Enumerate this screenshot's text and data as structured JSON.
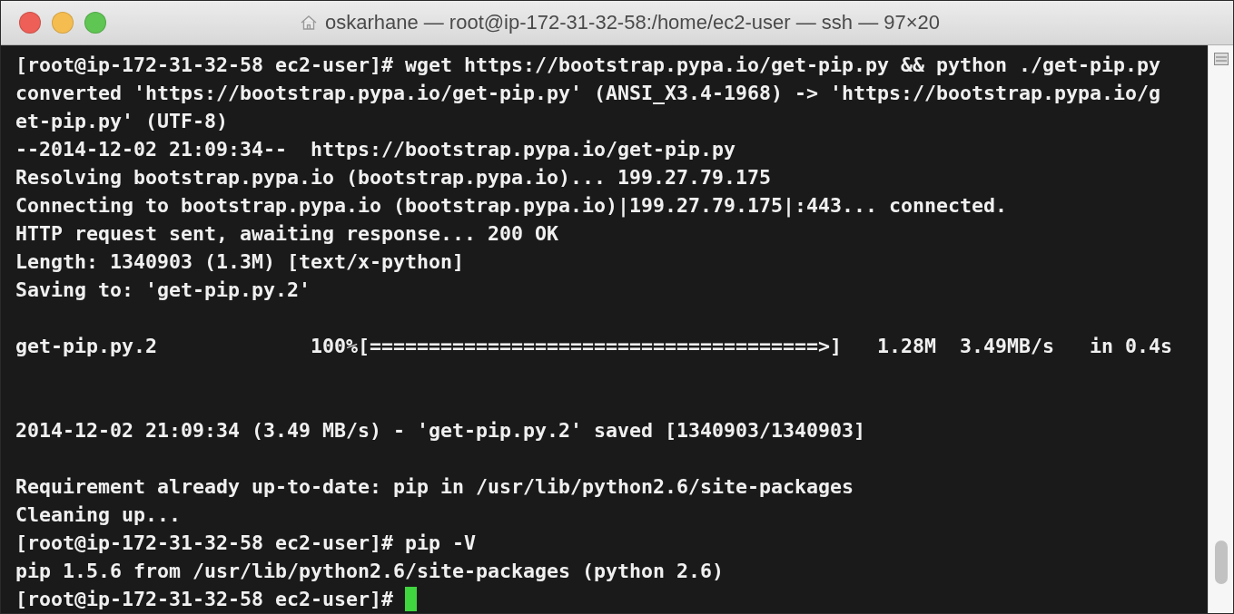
{
  "window": {
    "title": "oskarhane — root@ip-172-31-32-58:/home/ec2-user — ssh — 97×20"
  },
  "terminal": {
    "lines": [
      {
        "kind": "text",
        "text": "[root@ip-172-31-32-58 ec2-user]# wget https://bootstrap.pypa.io/get-pip.py && python ./get-pip.py",
        "cursor": false
      },
      {
        "kind": "text",
        "text": "converted 'https://bootstrap.pypa.io/get-pip.py' (ANSI_X3.4-1968) -> 'https://bootstrap.pypa.io/g",
        "cursor": false
      },
      {
        "kind": "text",
        "text": "et-pip.py' (UTF-8)",
        "cursor": false
      },
      {
        "kind": "text",
        "text": "--2014-12-02 21:09:34--  https://bootstrap.pypa.io/get-pip.py",
        "cursor": false
      },
      {
        "kind": "text",
        "text": "Resolving bootstrap.pypa.io (bootstrap.pypa.io)... 199.27.79.175",
        "cursor": false
      },
      {
        "kind": "text",
        "text": "Connecting to bootstrap.pypa.io (bootstrap.pypa.io)|199.27.79.175|:443... connected.",
        "cursor": false
      },
      {
        "kind": "text",
        "text": "HTTP request sent, awaiting response... 200 OK",
        "cursor": false
      },
      {
        "kind": "text",
        "text": "Length: 1340903 (1.3M) [text/x-python]",
        "cursor": false
      },
      {
        "kind": "text",
        "text": "Saving to: 'get-pip.py.2'",
        "cursor": false
      },
      {
        "kind": "blank"
      },
      {
        "kind": "text",
        "text": "get-pip.py.2             100%[======================================>]   1.28M  3.49MB/s   in 0.4s",
        "cursor": false
      },
      {
        "kind": "blank"
      },
      {
        "kind": "blank"
      },
      {
        "kind": "text",
        "text": "2014-12-02 21:09:34 (3.49 MB/s) - 'get-pip.py.2' saved [1340903/1340903]",
        "cursor": false
      },
      {
        "kind": "blank"
      },
      {
        "kind": "text",
        "text": "Requirement already up-to-date: pip in /usr/lib/python2.6/site-packages",
        "cursor": false
      },
      {
        "kind": "text",
        "text": "Cleaning up...",
        "cursor": false
      },
      {
        "kind": "text",
        "text": "[root@ip-172-31-32-58 ec2-user]# pip -V",
        "cursor": false
      },
      {
        "kind": "text",
        "text": "pip 1.5.6 from /usr/lib/python2.6/site-packages (python 2.6)",
        "cursor": false
      },
      {
        "kind": "text",
        "text": "[root@ip-172-31-32-58 ec2-user]# ",
        "cursor": true
      }
    ]
  }
}
